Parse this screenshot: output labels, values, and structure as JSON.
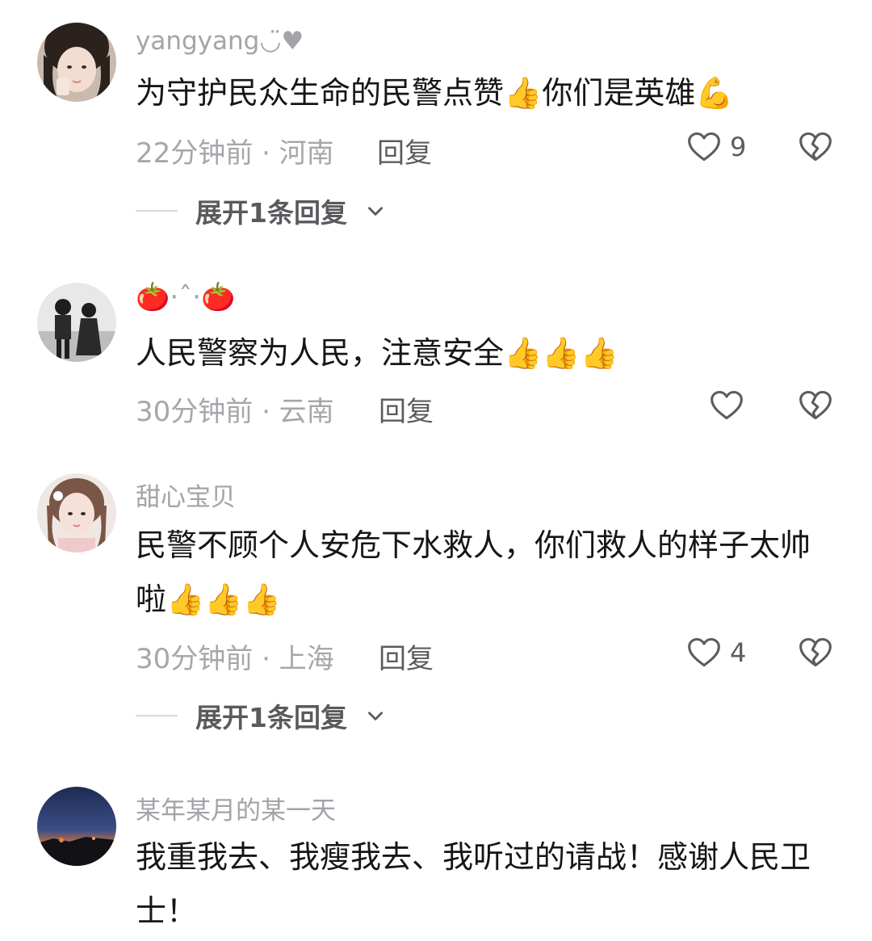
{
  "comments": [
    {
      "username": "yangyang◡̈♥",
      "text": "为守护民众生命的民警点赞👍你们是英雄💪",
      "time_location": "22分钟前 · 河南",
      "reply_label": "回复",
      "like_count": "9",
      "expand_label": "展开1条回复"
    },
    {
      "username": "🍅·ˆ·🍅",
      "text": "人民警察为人民，注意安全👍👍👍",
      "time_location": "30分钟前 · 云南",
      "reply_label": "回复",
      "like_count": ""
    },
    {
      "username": "甜心宝贝",
      "text": "民警不顾个人安危下水救人，你们救人的样子太帅啦👍👍👍",
      "time_location": "30分钟前 · 上海",
      "reply_label": "回复",
      "like_count": "4",
      "expand_label": "展开1条回复"
    },
    {
      "username": "某年某月的某一天",
      "text": "我重我去、我瘦我去、我听过的请战！感谢人民卫士！"
    }
  ],
  "icons": {
    "like": "heart-outline-icon",
    "dislike": "broken-heart-icon",
    "expand": "chevron-down-icon"
  },
  "colors": {
    "username": "#a3a3a8",
    "text": "#161616",
    "meta": "#a6a6ab",
    "action": "#5c5c60"
  }
}
